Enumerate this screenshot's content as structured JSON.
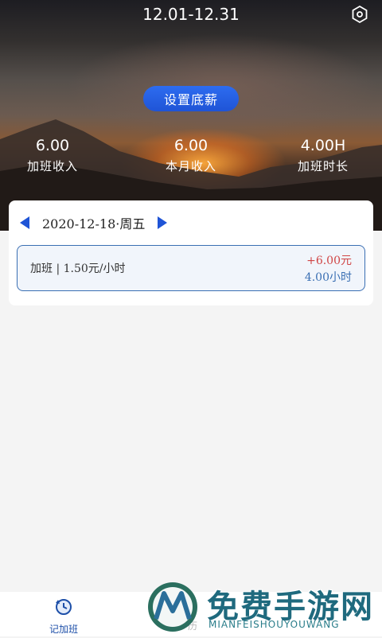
{
  "header": {
    "period": "12.01-12.31",
    "set_salary_label": "设置底薪"
  },
  "stats": [
    {
      "value": "6.00",
      "label": "加班收入"
    },
    {
      "value": "6.00",
      "label": "本月收入"
    },
    {
      "value": "4.00H",
      "label": "加班时长"
    }
  ],
  "day": {
    "date_label": "2020-12-18·周五",
    "entry": {
      "description": "加班 | 1.50元/小时",
      "amount": "+6.00元",
      "hours": "4.00小时"
    }
  },
  "bottom_nav": {
    "active_label": "记加班",
    "faded_label": "历"
  },
  "watermark": {
    "title": "免费手游网",
    "subtitle": "MIANFEISHOUYOUWANG"
  },
  "colors": {
    "accent": "#1f54d6",
    "income": "#d04545",
    "hours": "#3a6fb3"
  }
}
